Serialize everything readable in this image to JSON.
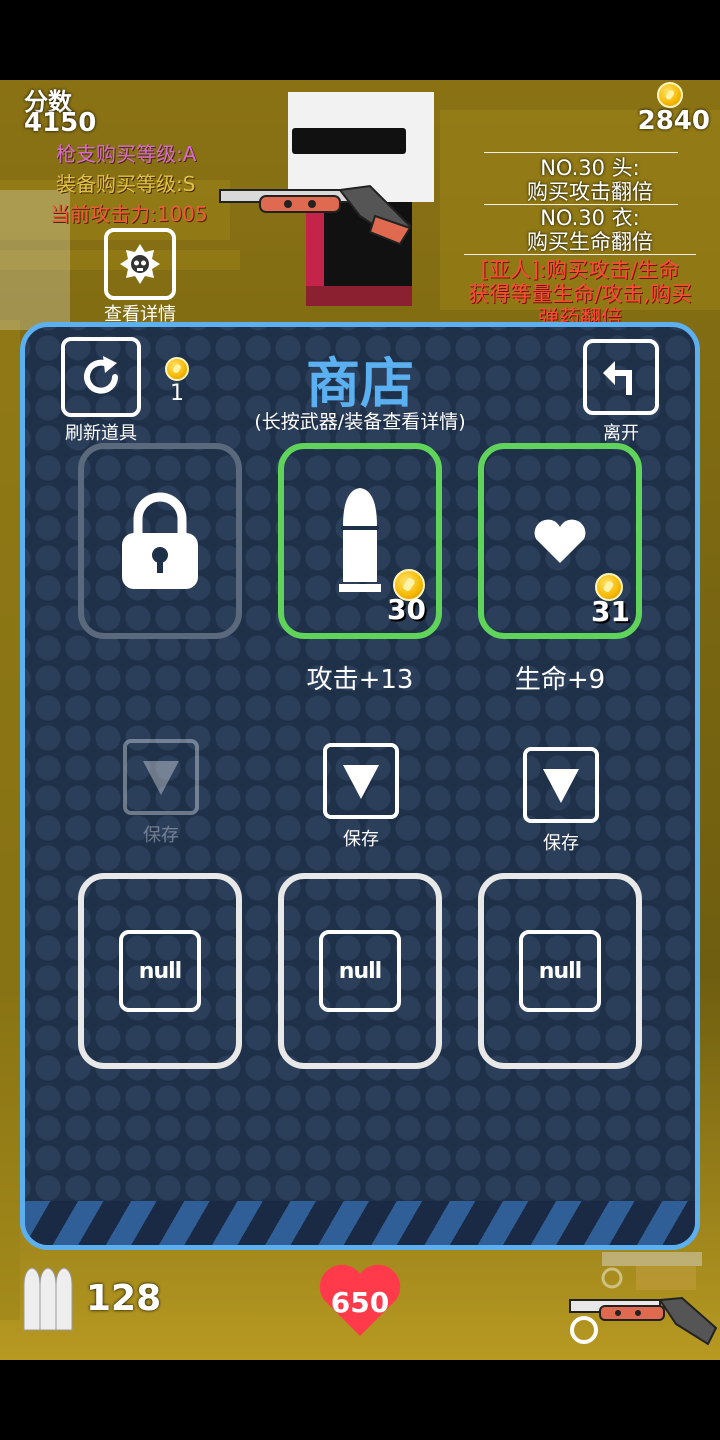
{
  "hud": {
    "score_label": "分数",
    "score_value": "4150",
    "gun_level": "枪支购买等级:A",
    "equip_level": "装备购买等级:S",
    "attack_power": "当前攻击力:1005",
    "view_details": "查看详情",
    "coins": "2840",
    "ammo": "128",
    "health": "650"
  },
  "info": {
    "head_line1": "NO.30 头:",
    "head_line2": "购买攻击翻倍",
    "body_line1": "NO.30 衣:",
    "body_line2": "购买生命翻倍",
    "race_line1": "[亚人]:购买攻击/生命",
    "race_line2": "获得等量生命/攻击,购买",
    "race_line3": "弹药翻倍"
  },
  "shop": {
    "title": "商店",
    "subtitle": "(长按武器/装备查看详情)",
    "refresh_label": "刷新道具",
    "refresh_cost": "1",
    "leave_label": "离开",
    "items": [
      {
        "name": "locked",
        "icon": "lock-icon"
      },
      {
        "icon": "bullet-icon",
        "price": "30",
        "label": "攻击+13"
      },
      {
        "icon": "heart-icon",
        "price": "31",
        "label": "生命+9"
      }
    ],
    "save_labels": [
      "保存",
      "保存",
      "保存"
    ],
    "storage": [
      "null",
      "null",
      "null"
    ]
  },
  "colors": {
    "panel_border": "#5db0f0",
    "panel_bg": "#1f3049",
    "active_slot": "#5fd35a",
    "coin": "#f5b800",
    "health": "#ff3a4a"
  }
}
